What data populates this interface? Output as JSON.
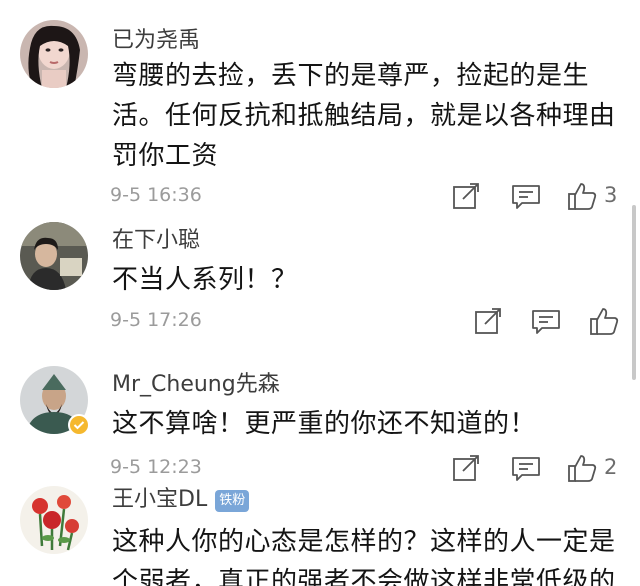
{
  "comments": [
    {
      "username": "已为尧禹",
      "text": "弯腰的去捡，丢下的是尊严，捡起的是生活。任何反抗和抵触结局，就是以各种理由罚你工资",
      "time": "9-5 16:36",
      "likes": "3"
    },
    {
      "username": "在下小聪",
      "text": "不当人系列！？",
      "time": "9-5 17:26",
      "likes": ""
    },
    {
      "username": "Mr_Cheung先森",
      "text": "这不算啥！更严重的你还不知道的！",
      "time": "9-5 12:23",
      "likes": "2"
    },
    {
      "username": "王小宝DL",
      "badge": "铁粉",
      "text": "这种人你的心态是怎样的？这样的人一定是个弱者，真正的强者不会做这样非常低级的",
      "time": "",
      "likes": ""
    }
  ],
  "icons": {
    "repost": "repost-icon",
    "comment": "comment-icon",
    "like": "thumbs-up-icon",
    "verified": "verified-badge-icon"
  },
  "colors": {
    "username": "#3d3d3d",
    "text": "#141414",
    "meta": "#9b9b9b",
    "badge": "#7aa6d8",
    "verified": "#f5b82e"
  }
}
